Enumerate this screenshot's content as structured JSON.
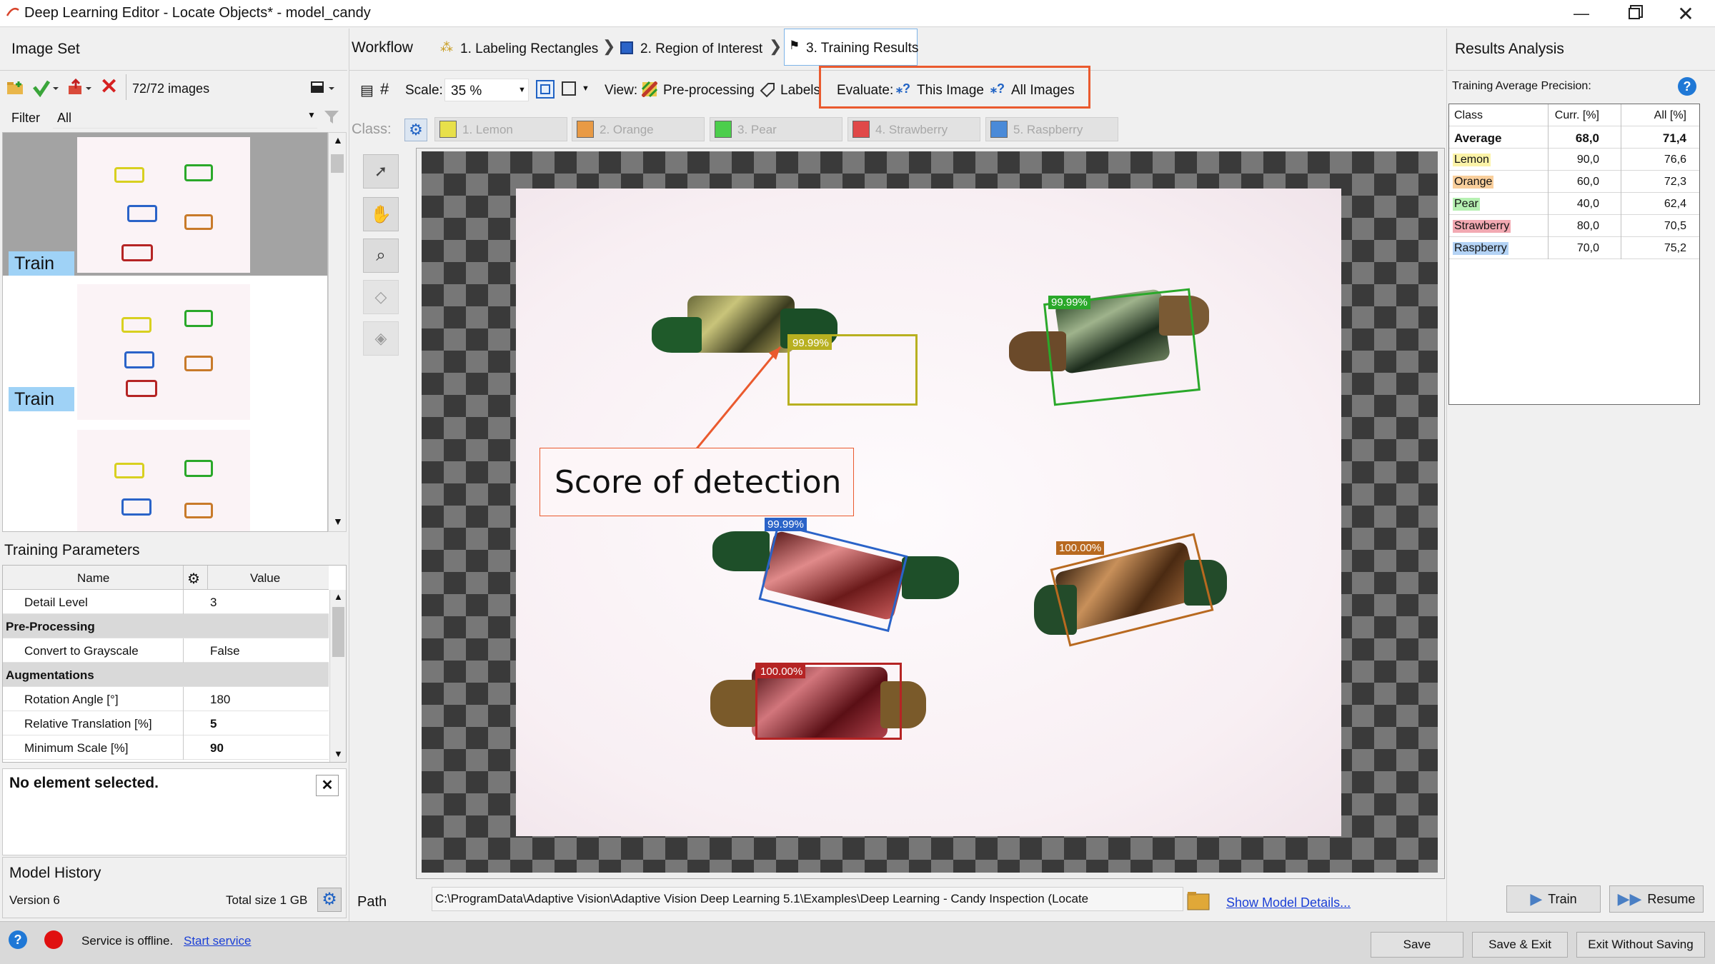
{
  "window": {
    "title": "Deep Learning Editor - Locate Objects* - model_candy"
  },
  "image_set": {
    "title": "Image Set",
    "count": "72/72 images",
    "filter_label": "Filter",
    "filter_value": "All",
    "thumbnails": [
      {
        "badge": "Train"
      },
      {
        "badge": "Train"
      },
      {
        "badge": ""
      }
    ]
  },
  "workflow": {
    "title": "Workflow",
    "steps": [
      "1. Labeling Rectangles",
      "2. Region of Interest",
      "3. Training Results"
    ],
    "active_step": 2
  },
  "toolbar": {
    "scale_label": "Scale:",
    "scale_value": "35 %",
    "view_label": "View:",
    "preprocessing_label": "Pre-processing",
    "labels_label": "Labels",
    "evaluate_label": "Evaluate:",
    "this_image_label": "This Image",
    "all_images_label": "All Images"
  },
  "classes": {
    "label": "Class:",
    "items": [
      {
        "name": "1. Lemon",
        "color": "#e8e04a"
      },
      {
        "name": "2. Orange",
        "color": "#e89a45"
      },
      {
        "name": "3. Pear",
        "color": "#4cce4c"
      },
      {
        "name": "4. Strawberry",
        "color": "#e04848"
      },
      {
        "name": "5. Raspberry",
        "color": "#4a8ad8"
      }
    ]
  },
  "detections": [
    {
      "score": "99.99%",
      "class": "Lemon",
      "color": "#b8b020"
    },
    {
      "score": "99.99%",
      "class": "Pear",
      "color": "#2aa82a"
    },
    {
      "score": "99.99%",
      "class": "Raspberry",
      "color": "#2a63c8"
    },
    {
      "score": "100.00%",
      "class": "Orange",
      "color": "#b8691f"
    },
    {
      "score": "100.00%",
      "class": "Strawberry",
      "color": "#b52424"
    }
  ],
  "annotation": {
    "text": "Score of detection"
  },
  "training_parameters": {
    "title": "Training Parameters",
    "col_name": "Name",
    "col_value": "Value",
    "rows": [
      {
        "name": "Detail Level",
        "value": "3",
        "group": false
      },
      {
        "name": "Pre-Processing",
        "value": "",
        "group": true
      },
      {
        "name": "Convert to Grayscale",
        "value": "False",
        "group": false
      },
      {
        "name": "Augmentations",
        "value": "",
        "group": true
      },
      {
        "name": "Rotation Angle [°]",
        "value": "180",
        "group": false
      },
      {
        "name": "Relative Translation [%]",
        "value": "5",
        "group": false
      },
      {
        "name": "Minimum Scale [%]",
        "value": "90",
        "group": false
      }
    ]
  },
  "selection": {
    "text": "No element selected."
  },
  "model_history": {
    "title": "Model History",
    "version": "Version 6",
    "total_size": "Total size 1 GB"
  },
  "path": {
    "label": "Path",
    "value": "C:\\ProgramData\\Adaptive Vision\\Adaptive Vision Deep Learning 5.1\\Examples\\Deep Learning - Candy Inspection (Locate",
    "details_link": "Show Model Details..."
  },
  "results": {
    "title": "Results Analysis",
    "subtitle": "Training Average Precision:",
    "headers": [
      "Class",
      "Curr. [%]",
      "All [%]"
    ],
    "rows": [
      {
        "class": "Average",
        "curr": "68,0",
        "all": "71,4",
        "color": ""
      },
      {
        "class": "Lemon",
        "curr": "90,0",
        "all": "76,6",
        "color": "#fbf3a8"
      },
      {
        "class": "Orange",
        "curr": "60,0",
        "all": "72,3",
        "color": "#f9cf9c"
      },
      {
        "class": "Pear",
        "curr": "40,0",
        "all": "62,4",
        "color": "#b6f0b2"
      },
      {
        "class": "Strawberry",
        "curr": "80,0",
        "all": "70,5",
        "color": "#f2a9b2"
      },
      {
        "class": "Raspberry",
        "curr": "70,0",
        "all": "75,2",
        "color": "#b4d3f5"
      }
    ]
  },
  "actions": {
    "train": "Train",
    "resume": "Resume",
    "save": "Save",
    "save_exit": "Save & Exit",
    "exit_no_save": "Exit Without Saving"
  },
  "status": {
    "text": "Service is offline.",
    "start_link": "Start service"
  }
}
